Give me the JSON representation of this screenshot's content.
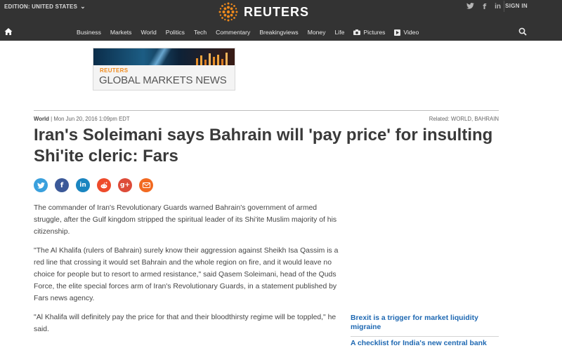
{
  "header": {
    "edition": "EDITION: UNITED STATES",
    "logo_text": "REUTERS",
    "signin": "SIGN IN",
    "social": [
      "twitter-icon",
      "facebook-icon",
      "linkedin-icon"
    ],
    "nav": [
      "Business",
      "Markets",
      "World",
      "Politics",
      "Tech",
      "Commentary",
      "Breakingviews",
      "Money",
      "Life",
      "Pictures",
      "Video"
    ]
  },
  "ad": {
    "brand": "REUTERS",
    "title": "GLOBAL MARKETS NEWS"
  },
  "article": {
    "section": "World",
    "date": "Mon Jun 20, 2016 1:09pm EDT",
    "related": "Related: WORLD, BAHRAIN",
    "headline": "Iran's Soleimani says Bahrain will 'pay price' for insulting Shi'ite cleric: Fars",
    "paragraphs": [
      "The commander of Iran's Revolutionary Guards warned Bahrain's government of armed struggle, after the Gulf kingdom stripped the spiritual leader of its Shi'ite Muslim majority of his citizenship.",
      "\"The Al Khalifa (rulers of Bahrain) surely know their aggression against Sheikh Isa Qassim is a red line that crossing it would set Bahrain and the whole region on fire, and it would leave no choice for people but to resort to armed resistance,\" said Qasem Soleimani, head of the Quds Force, the elite special forces arm of Iran's Revolutionary Guards, in a statement published by Fars news agency.",
      "\"Al Khalifa will definitely pay the price for that and their bloodthirsty regime will be toppled,\" he said."
    ]
  },
  "share": [
    {
      "name": "twitter",
      "glyph": "t",
      "color": "#3aa0dd"
    },
    {
      "name": "facebook",
      "glyph": "f",
      "color": "#3b5998"
    },
    {
      "name": "linkedin",
      "glyph": "in",
      "color": "#1a85c0"
    },
    {
      "name": "reddit",
      "glyph": "r",
      "color": "#ee4b2b"
    },
    {
      "name": "googleplus",
      "glyph": "g+",
      "color": "#dd4b39"
    },
    {
      "name": "email",
      "glyph": "✉",
      "color": "#f26a21"
    }
  ],
  "sidebar": {
    "links": [
      "Brexit is a trigger for market liquidity migraine",
      "A checklist for India's new central bank"
    ]
  },
  "colors": {
    "header_bg": "#333333",
    "logo_orange": "#f08a1c",
    "link_blue": "#1e68b2"
  }
}
